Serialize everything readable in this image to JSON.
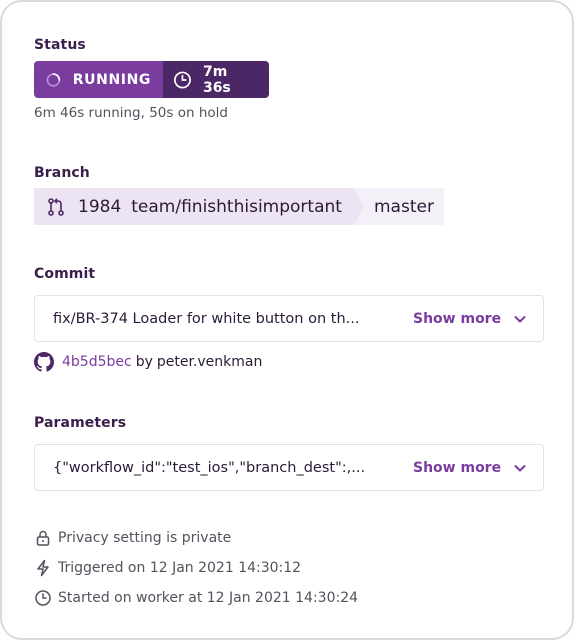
{
  "status": {
    "title": "Status",
    "state_label": "RUNNING",
    "duration": "7m 36s",
    "subtext": "6m 46s running, 50s on hold",
    "icons": {
      "state": "spinner-icon",
      "duration": "clock-icon"
    },
    "colors": {
      "running_bg": "#7b3ca0",
      "duration_bg": "#4c2766"
    }
  },
  "branch": {
    "title": "Branch",
    "pr_number": "1984",
    "source": "team/finishthisimportant",
    "target": "master",
    "icon": "pull-request-icon"
  },
  "commit": {
    "title": "Commit",
    "message": "fix/BR-374 Loader for white button on th...",
    "show_more_label": "Show more",
    "hash": "4b5d5bec",
    "by_label": "by",
    "author": "peter.venkman",
    "icon": "github-icon"
  },
  "parameters": {
    "title": "Parameters",
    "value": "{\"workflow_id\":\"test_ios\",\"branch_dest\":,...",
    "show_more_label": "Show more"
  },
  "info": {
    "privacy": "Privacy setting is private",
    "triggered": "Triggered on 12 Jan 2021 14:30:12",
    "started": "Started on worker at 12 Jan 2021 14:30:24",
    "icons": [
      "lock-icon",
      "lightning-icon",
      "clock-icon"
    ]
  },
  "accent_color": "#7b3ca0"
}
